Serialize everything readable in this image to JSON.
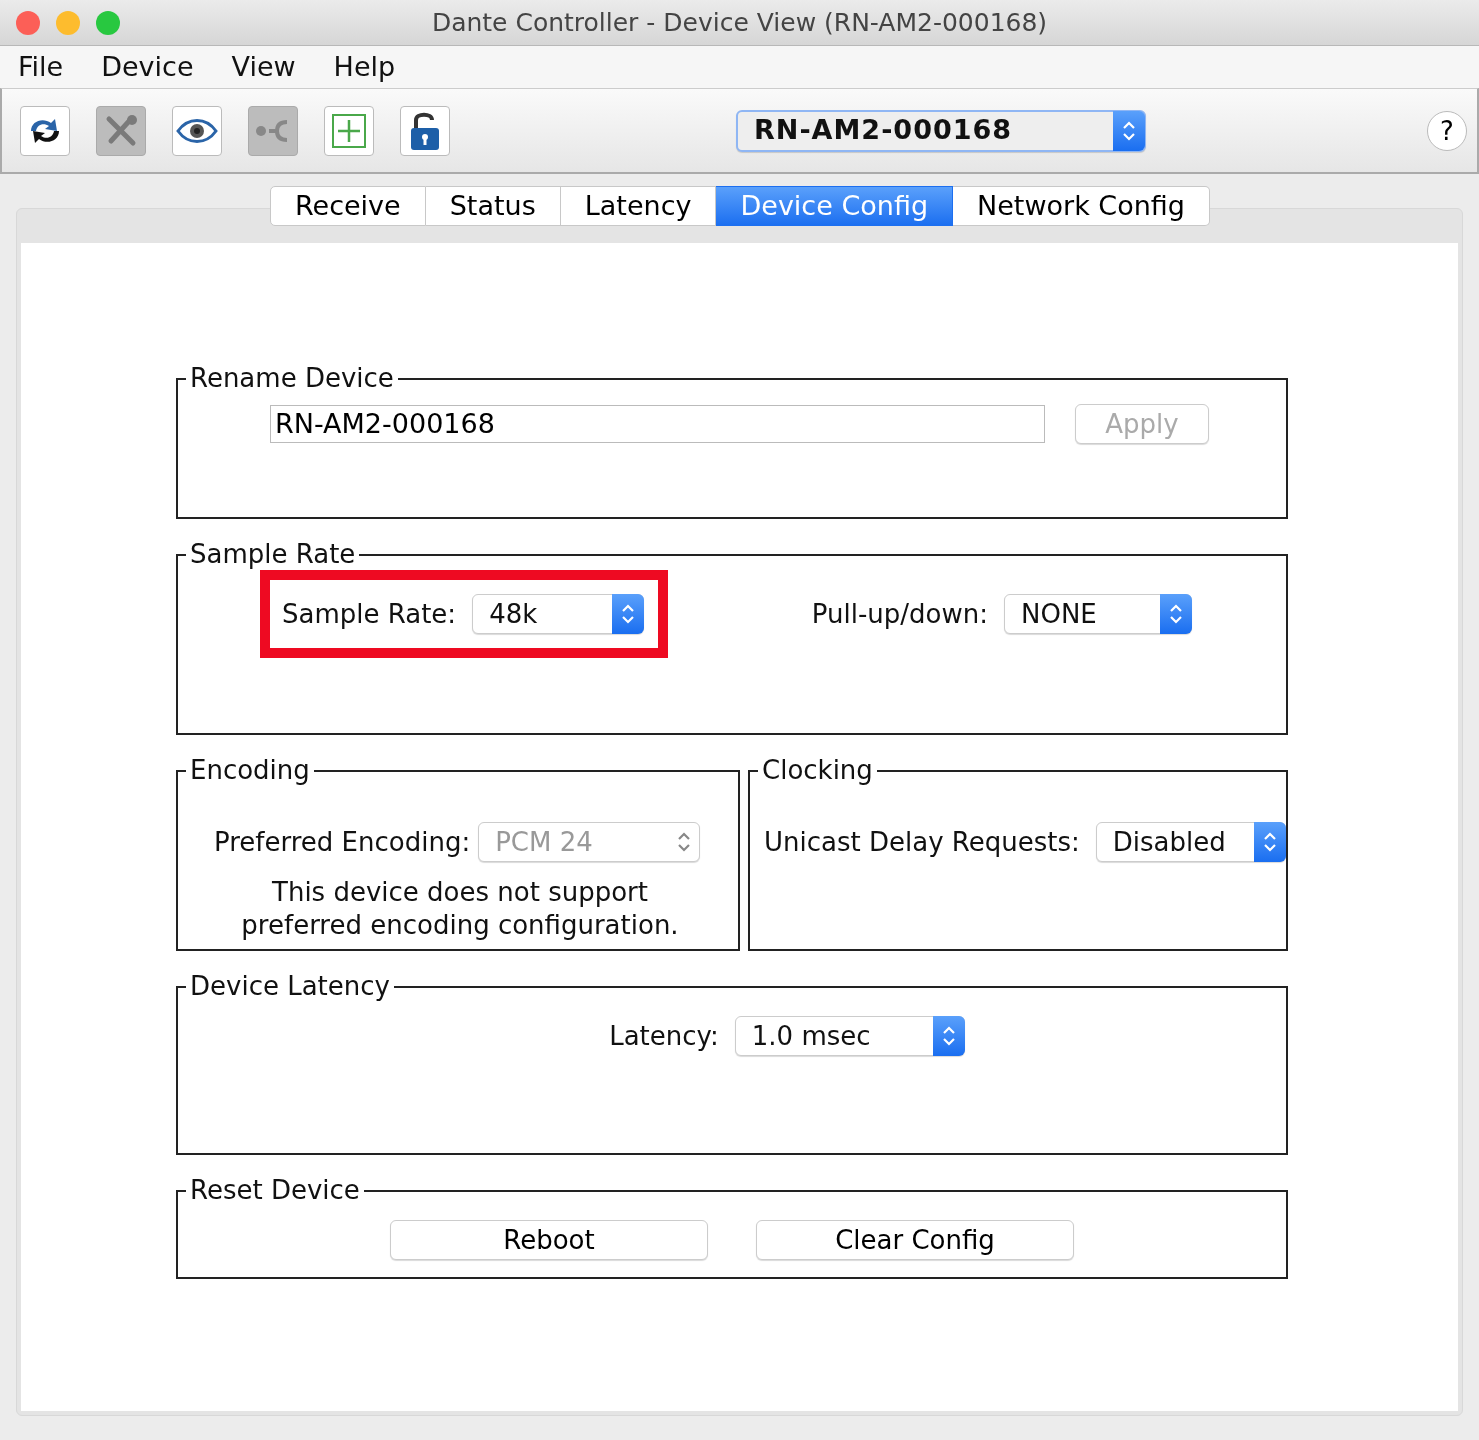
{
  "window": {
    "title": "Dante Controller - Device View (RN-AM2-000168)"
  },
  "menu": [
    "File",
    "Device",
    "View",
    "Help"
  ],
  "toolbar": {
    "buttons": [
      {
        "kind": "refresh",
        "disabled": false
      },
      {
        "kind": "tools",
        "disabled": true
      },
      {
        "kind": "eye",
        "disabled": false
      },
      {
        "kind": "connect",
        "disabled": true
      },
      {
        "kind": "add",
        "disabled": false
      },
      {
        "kind": "lock",
        "disabled": false
      }
    ],
    "device_select": {
      "value": "RN-AM2-000168"
    },
    "help": "?"
  },
  "tabs": [
    {
      "label": "Receive",
      "selected": false
    },
    {
      "label": "Status",
      "selected": false
    },
    {
      "label": "Latency",
      "selected": false
    },
    {
      "label": "Device Config",
      "selected": true
    },
    {
      "label": "Network Config",
      "selected": false
    }
  ],
  "rename": {
    "title": "Rename Device",
    "value": "RN-AM2-000168",
    "button": {
      "label": "Apply",
      "disabled": true
    }
  },
  "sample_rate": {
    "title": "Sample Rate",
    "fields": [
      {
        "label": "Sample Rate:",
        "value": "48k",
        "highlighted": true
      },
      {
        "label": "Pull-up/down:",
        "value": "NONE",
        "highlighted": false
      }
    ]
  },
  "encoding": {
    "title": "Encoding",
    "label": "Preferred Encoding:",
    "value": "PCM 24",
    "disabled": true,
    "note": "This device does not support preferred encoding configuration."
  },
  "clocking": {
    "title": "Clocking",
    "label": "Unicast Delay Requests:",
    "value": "Disabled"
  },
  "latency": {
    "title": "Device Latency",
    "label": "Latency:",
    "value": "1.0 msec"
  },
  "reset": {
    "title": "Reset Device",
    "buttons": [
      "Reboot",
      "Clear Config"
    ]
  }
}
